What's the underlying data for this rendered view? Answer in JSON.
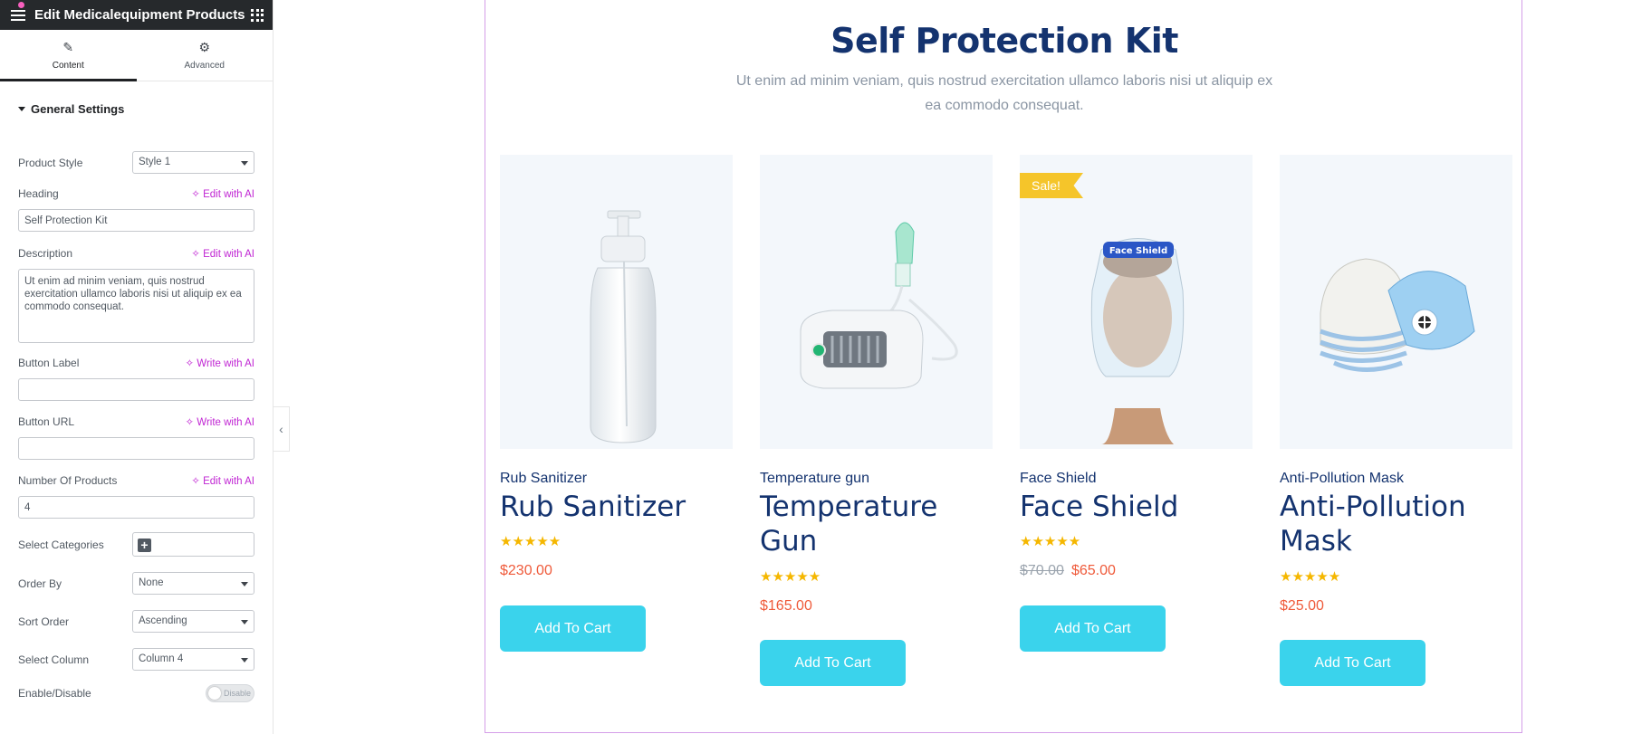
{
  "editor": {
    "title": "Edit Medicalequipment Products",
    "tabs": [
      {
        "label": "Content",
        "icon": "pencil-icon"
      },
      {
        "label": "Advanced",
        "icon": "gear-icon"
      }
    ],
    "section_title": "General Settings",
    "collapse_icon": "chevron-left-icon",
    "fields": {
      "product_style": {
        "label": "Product Style",
        "value": "Style 1"
      },
      "heading": {
        "label": "Heading",
        "ai_label": "Edit with AI",
        "value": "Self Protection Kit"
      },
      "description": {
        "label": "Description",
        "ai_label": "Edit with AI",
        "value": "Ut enim ad minim veniam, quis nostrud exercitation ullamco laboris nisi ut aliquip ex ea commodo consequat."
      },
      "button_label": {
        "label": "Button Label",
        "ai_label": "Write with AI",
        "value": ""
      },
      "button_url": {
        "label": "Button URL",
        "ai_label": "Write with AI",
        "value": ""
      },
      "number_of_products": {
        "label": "Number Of Products",
        "ai_label": "Edit with AI",
        "value": "4"
      },
      "select_categories": {
        "label": "Select Categories",
        "add_symbol": "+"
      },
      "order_by": {
        "label": "Order By",
        "value": "None"
      },
      "sort_order": {
        "label": "Sort Order",
        "value": "Ascending"
      },
      "select_column": {
        "label": "Select Column",
        "value": "Column 4"
      },
      "enable_disable": {
        "label": "Enable/Disable",
        "value": "Disable"
      }
    }
  },
  "preview": {
    "heading": "Self Protection Kit",
    "description": "Ut enim ad minim veniam, quis nostrud exercitation ullamco laboris nisi ut aliquip ex ea commodo consequat.",
    "products": [
      {
        "category": "Rub Sanitizer",
        "name": "Rub Sanitizer",
        "rating": "★★★★★",
        "old_price": "",
        "price": "$230.00",
        "button": "Add To Cart",
        "badge": ""
      },
      {
        "category": "Temperature gun",
        "name": "Temperature Gun",
        "rating": "★★★★★",
        "old_price": "",
        "price": "$165.00",
        "button": "Add To Cart",
        "badge": ""
      },
      {
        "category": "Face Shield",
        "name": "Face Shield",
        "rating": "★★★★★",
        "old_price": "$70.00",
        "price": "$65.00",
        "button": "Add To Cart",
        "badge": "Sale!"
      },
      {
        "category": "Anti-Pollution Mask",
        "name": "Anti-Pollution Mask",
        "rating": "★★★★★",
        "old_price": "",
        "price": "$25.00",
        "button": "Add To Cart",
        "badge": ""
      }
    ]
  },
  "colors": {
    "heading": "#14336f",
    "price": "#ef5a3a",
    "button": "#3ad3ec",
    "star": "#f5b700",
    "sale": "#f5c52a",
    "ai_accent": "#c026d3",
    "editor_bar": "#26292c"
  }
}
